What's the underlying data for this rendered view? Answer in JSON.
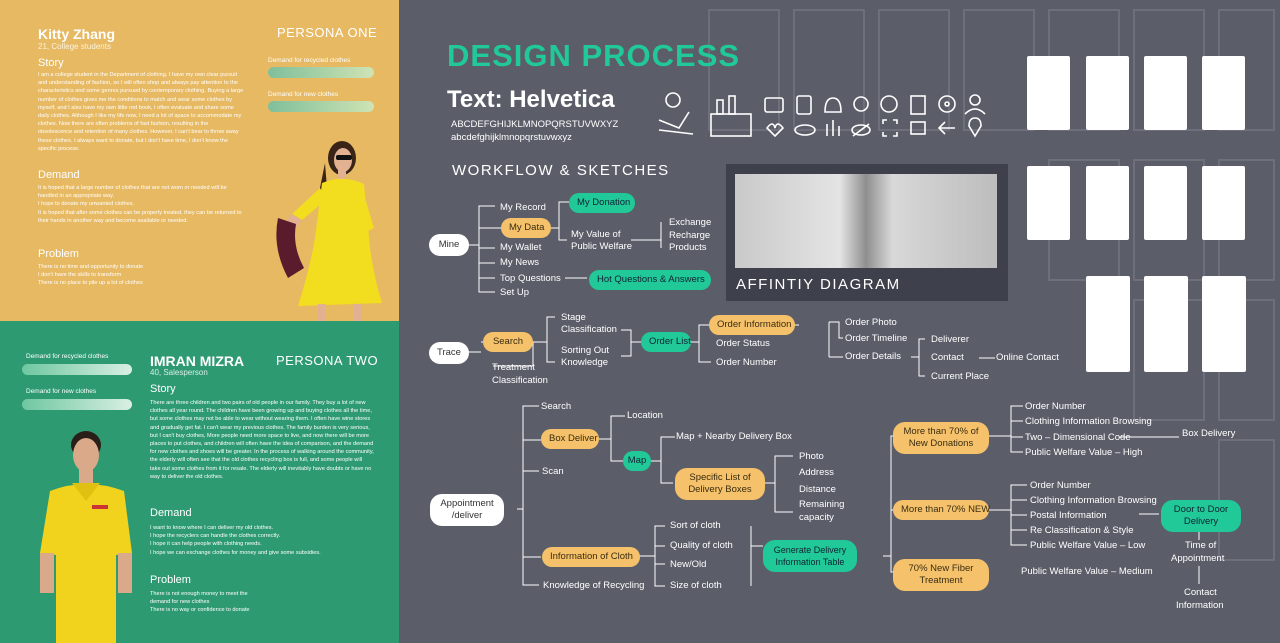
{
  "persona1": {
    "name": "Kitty Zhang",
    "sub": "21,  College students",
    "title": "PERSONA ONE",
    "bar1": "Demand for recycled clothes",
    "bar2": "Demand for new clothes",
    "story_h": "Story",
    "story": "I am a college student in the Department of clothing. I have my own clear pursuit and understanding of fashion, so I will often shop and always pay attention to the characteristics and some genres pursued by contemporary clothing. Buying a large number of clothes gives me the conditions to match and wear some clothes by myself, and I also have my own little red book, I often evaluate and share some daily clothes. Although I like my life now, I need a lot of space to accommodate my clothes. Now there are often problems of fast fashion, resulting in the obsolescence and retention of many clothes. However, I can't bear to throw away these clothes. I always want to donate, but I don't have time, I don't know the specific process.",
    "demand_h": "Demand",
    "demand": [
      "It is hoped that a large number of clothes that are not worn or needed will be handled in an appropriate way.",
      "I hope to donate my unwanted clothes.",
      "It is hoped that after some clothes can be properly treated, they can be returned to their hands in another way and become available or needed."
    ],
    "problem_h": "Problem",
    "problem": [
      "There is no time and opportunity to donate",
      "I don't have the skills to transform",
      "There is no place to pile up a lot of clothes"
    ]
  },
  "persona2": {
    "name": "IMRAN MIZRA",
    "sub": "40,  Salesperson",
    "title": "PERSONA TWO",
    "bar1": "Demand for recycled clothes",
    "bar2": "Demand for new clothes",
    "story_h": "Story",
    "story": "There are three children and two pairs of old people in our family. They buy a lot of new clothes all year round. The children have been growing up and buying clothes all the time, but some clothes may not be able to wear without wearing them. I often have wine stores and gradually get fat. I can't wear my previous clothes. The family burden is very serious, but I can't buy clothes, More people need more space to live, and now there will be more places to put clothes, and children will often have the idea of comparison, and the demand for new clothes and shoes will be greater. In the process of walking around the community, the elderly will often see that the old clothes recycling box is full, and some people will take out some clothes from it for resale. The elderly will inevitably have doubts or have no way to deliver the old clothes.",
    "demand_h": "Demand",
    "demand": [
      "I want to know where I can deliver my old clothes.",
      "I hope the recyclers can handle the clothes correctly.",
      "I hope it can help people with clothing needs.",
      "I hope we can exchange clothes for money and give some subsidies."
    ],
    "problem_h": "Problem",
    "problem": [
      "There is not enough money to meet the",
      "demand for new clothes",
      "There is no way or confidence to donate"
    ]
  },
  "header": {
    "design_process": "DESIGN PROCESS",
    "font_title": "Text: Helvetica",
    "upper": "ABCDEFGHIJKLMNOPQRSTUVWXYZ",
    "lower": "abcdefghijklmnopqrstuvwxyz",
    "workflow": "WORKFLOW & SKETCHES",
    "affinity": "AFFINTIY DIAGRAM"
  },
  "mine": {
    "root": "Mine",
    "my_record": "My Record",
    "my_data": "My Data",
    "my_donation": "My Donation",
    "my_value": "My Value of",
    "public_welfare": "Public Welfare",
    "exchange": "Exchange",
    "recharge": "Recharge",
    "products": "Products",
    "my_wallet": "My Wallet",
    "my_news": "My News",
    "top_questions": "Top Questions",
    "hot_questions": "Hot Questions & Answers",
    "set_up": "Set Up"
  },
  "trace": {
    "root": "Trace",
    "search": "Search",
    "stage": "Stage",
    "classification": "Classification",
    "sorting_out": "Sorting Out",
    "knowledge": "Knowledge",
    "treatment": "Treatment",
    "treatment_class": "Classification",
    "order_list": "Order List",
    "order_info": "Order Information",
    "order_status": "Order Status",
    "order_number": "Order Number",
    "order_photo": "Order Photo",
    "order_timeline": "Order Timeline",
    "order_details": "Order Details",
    "deliverer": "Deliverer",
    "contact": "Contact",
    "online_contact": "Online Contact",
    "current_place": "Current Place"
  },
  "appointment": {
    "root_l1": "Appointment",
    "root_l2": "/deliver",
    "search": "Search",
    "box_deliver": "Box Deliver",
    "location": "Location",
    "map": "Map",
    "map_nearby": "Map + Nearby Delivery Box",
    "scan": "Scan",
    "specific_l1": "Specific List of",
    "specific_l2": "Delivery Boxes",
    "photo": "Photo",
    "address": "Address",
    "distance": "Distance",
    "remaining": "Remaining",
    "capacity": "capacity",
    "info_cloth": "Information of Cloth",
    "sort_cloth": "Sort of cloth",
    "quality_cloth": "Quality of cloth",
    "new_old": "New/Old",
    "size_cloth": "Size of cloth",
    "knowledge_recycling": "Knowledge of Recycling",
    "generate_l1": "Generate Delivery",
    "generate_l2": "Information Table",
    "more70_l1": "More than 70% of",
    "more70_l2": "New Donations",
    "more70new": "More than 70% NEW",
    "fiber_l1": "70% New Fiber",
    "fiber_l2": "Treatment",
    "a_order_number": "Order Number",
    "a_cloth_info": "Clothing Information Browsing",
    "a_two_dim": "Two – Dimensional Code",
    "a_public_high": "Public Welfare Value – High",
    "box_delivery": "Box Delivery",
    "b_order_number": "Order Number",
    "b_cloth_info": "Clothing Information Browsing",
    "b_postal": "Postal Information",
    "b_reclass": "Re Classification & Style",
    "b_public_low": "Public Welfare Value – Low",
    "door_l1": "Door to Door",
    "door_l2": "Delivery",
    "time_l1": "Time of",
    "time_l2": "Appointment",
    "contact_l1": "Contact",
    "contact_l2": "Information",
    "c_public_medium": "Public Welfare Value – Medium"
  },
  "colors": {
    "accent_green": "#20c997",
    "accent_yellow": "#f5c26b",
    "persona_one_bg": "#e6b962",
    "persona_two_bg": "#2e9a72",
    "panel_bg": "#5b5e69"
  }
}
